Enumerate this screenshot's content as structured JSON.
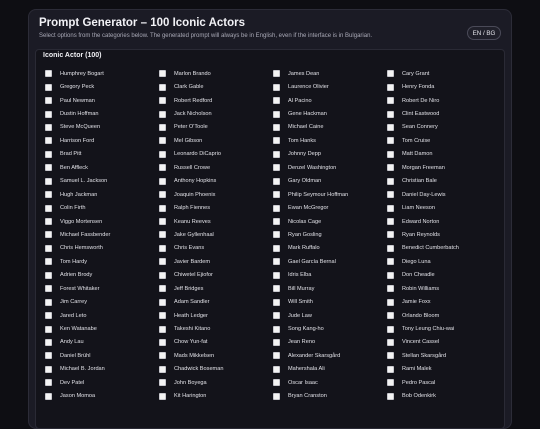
{
  "header": {
    "title": "Prompt Generator – 100 Iconic Actors",
    "subtitle": "Select options from the categories below. The generated prompt will always be in English, even if the interface is in Bulgarian.",
    "lang_toggle": "EN / BG"
  },
  "section": {
    "title": "Iconic Actor (100)",
    "options": [
      "Humphrey Bogart",
      "Marlon Brando",
      "James Dean",
      "Cary Grant",
      "Gregory Peck",
      "Clark Gable",
      "Laurence Olivier",
      "Henry Fonda",
      "Paul Newman",
      "Robert Redford",
      "Al Pacino",
      "Robert De Niro",
      "Dustin Hoffman",
      "Jack Nicholson",
      "Gene Hackman",
      "Clint Eastwood",
      "Steve McQueen",
      "Peter O'Toole",
      "Michael Caine",
      "Sean Connery",
      "Harrison Ford",
      "Mel Gibson",
      "Tom Hanks",
      "Tom Cruise",
      "Brad Pitt",
      "Leonardo DiCaprio",
      "Johnny Depp",
      "Matt Damon",
      "Ben Affleck",
      "Russell Crowe",
      "Denzel Washington",
      "Morgan Freeman",
      "Samuel L. Jackson",
      "Anthony Hopkins",
      "Gary Oldman",
      "Christian Bale",
      "Hugh Jackman",
      "Joaquin Phoenix",
      "Philip Seymour Hoffman",
      "Daniel Day-Lewis",
      "Colin Firth",
      "Ralph Fiennes",
      "Ewan McGregor",
      "Liam Neeson",
      "Viggo Mortensen",
      "Keanu Reeves",
      "Nicolas Cage",
      "Edward Norton",
      "Michael Fassbender",
      "Jake Gyllenhaal",
      "Ryan Gosling",
      "Ryan Reynolds",
      "Chris Hemsworth",
      "Chris Evans",
      "Mark Ruffalo",
      "Benedict Cumberbatch",
      "Tom Hardy",
      "Javier Bardem",
      "Gael García Bernal",
      "Diego Luna",
      "Adrien Brody",
      "Chiwetel Ejiofor",
      "Idris Elba",
      "Don Cheadle",
      "Forest Whitaker",
      "Jeff Bridges",
      "Bill Murray",
      "Robin Williams",
      "Jim Carrey",
      "Adam Sandler",
      "Will Smith",
      "Jamie Foxx",
      "Jared Leto",
      "Heath Ledger",
      "Jude Law",
      "Orlando Bloom",
      "Ken Watanabe",
      "Takeshi Kitano",
      "Song Kang-ho",
      "Tony Leung Chiu-wai",
      "Andy Lau",
      "Chow Yun-fat",
      "Jean Reno",
      "Vincent Cassel",
      "Daniel Brühl",
      "Mads Mikkelsen",
      "Alexander Skarsgård",
      "Stellan Skarsgård",
      "Michael B. Jordan",
      "Chadwick Boseman",
      "Mahershala Ali",
      "Rami Malek",
      "Dev Patel",
      "John Boyega",
      "Oscar Isaac",
      "Pedro Pascal",
      "Jason Momoa",
      "Kit Harington",
      "Bryan Cranston",
      "Bob Odenkirk"
    ]
  }
}
